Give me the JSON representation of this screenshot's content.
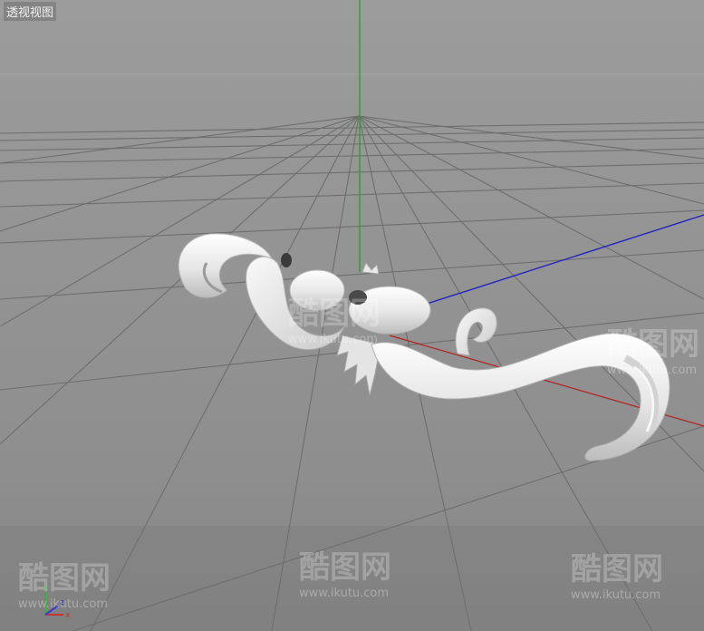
{
  "viewport": {
    "title": "透视视图"
  },
  "axes_gizmo": {
    "x_label": "x",
    "y_label": "y",
    "z_label": "z"
  },
  "watermarks": [
    {
      "logo": "酷图网",
      "url": "www.ikutu.com"
    },
    {
      "logo": "酷图网",
      "url": "www.ikutu.com"
    },
    {
      "logo": "酷图网",
      "url": "www.ikutu.com"
    },
    {
      "logo": "酷图网",
      "url": "www.ikutu.com"
    },
    {
      "logo": "酷图网",
      "url": "www.ikutu.com"
    }
  ],
  "colors": {
    "background": "#8f8f8f",
    "grid": "#6b6b6b",
    "axis_x": "#b02020",
    "axis_y": "#1a9a1a",
    "axis_z": "#1f1fb8",
    "model": "#e9e9e9"
  }
}
